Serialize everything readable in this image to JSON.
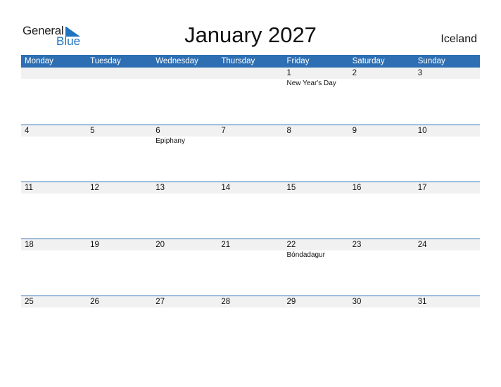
{
  "logo": {
    "word1": "General",
    "word2": "Blue"
  },
  "title": "January 2027",
  "country": "Iceland",
  "weekdays": [
    "Monday",
    "Tuesday",
    "Wednesday",
    "Thursday",
    "Friday",
    "Saturday",
    "Sunday"
  ],
  "weeks": [
    {
      "days": [
        "",
        "",
        "",
        "",
        "1",
        "2",
        "3"
      ],
      "events": [
        "",
        "",
        "",
        "",
        "New Year's Day",
        "",
        ""
      ]
    },
    {
      "days": [
        "4",
        "5",
        "6",
        "7",
        "8",
        "9",
        "10"
      ],
      "events": [
        "",
        "",
        "Epiphany",
        "",
        "",
        "",
        ""
      ]
    },
    {
      "days": [
        "11",
        "12",
        "13",
        "14",
        "15",
        "16",
        "17"
      ],
      "events": [
        "",
        "",
        "",
        "",
        "",
        "",
        ""
      ]
    },
    {
      "days": [
        "18",
        "19",
        "20",
        "21",
        "22",
        "23",
        "24"
      ],
      "events": [
        "",
        "",
        "",
        "",
        "Bóndadagur",
        "",
        ""
      ]
    },
    {
      "days": [
        "25",
        "26",
        "27",
        "28",
        "29",
        "30",
        "31"
      ],
      "events": [
        "",
        "",
        "",
        "",
        "",
        "",
        ""
      ]
    }
  ]
}
